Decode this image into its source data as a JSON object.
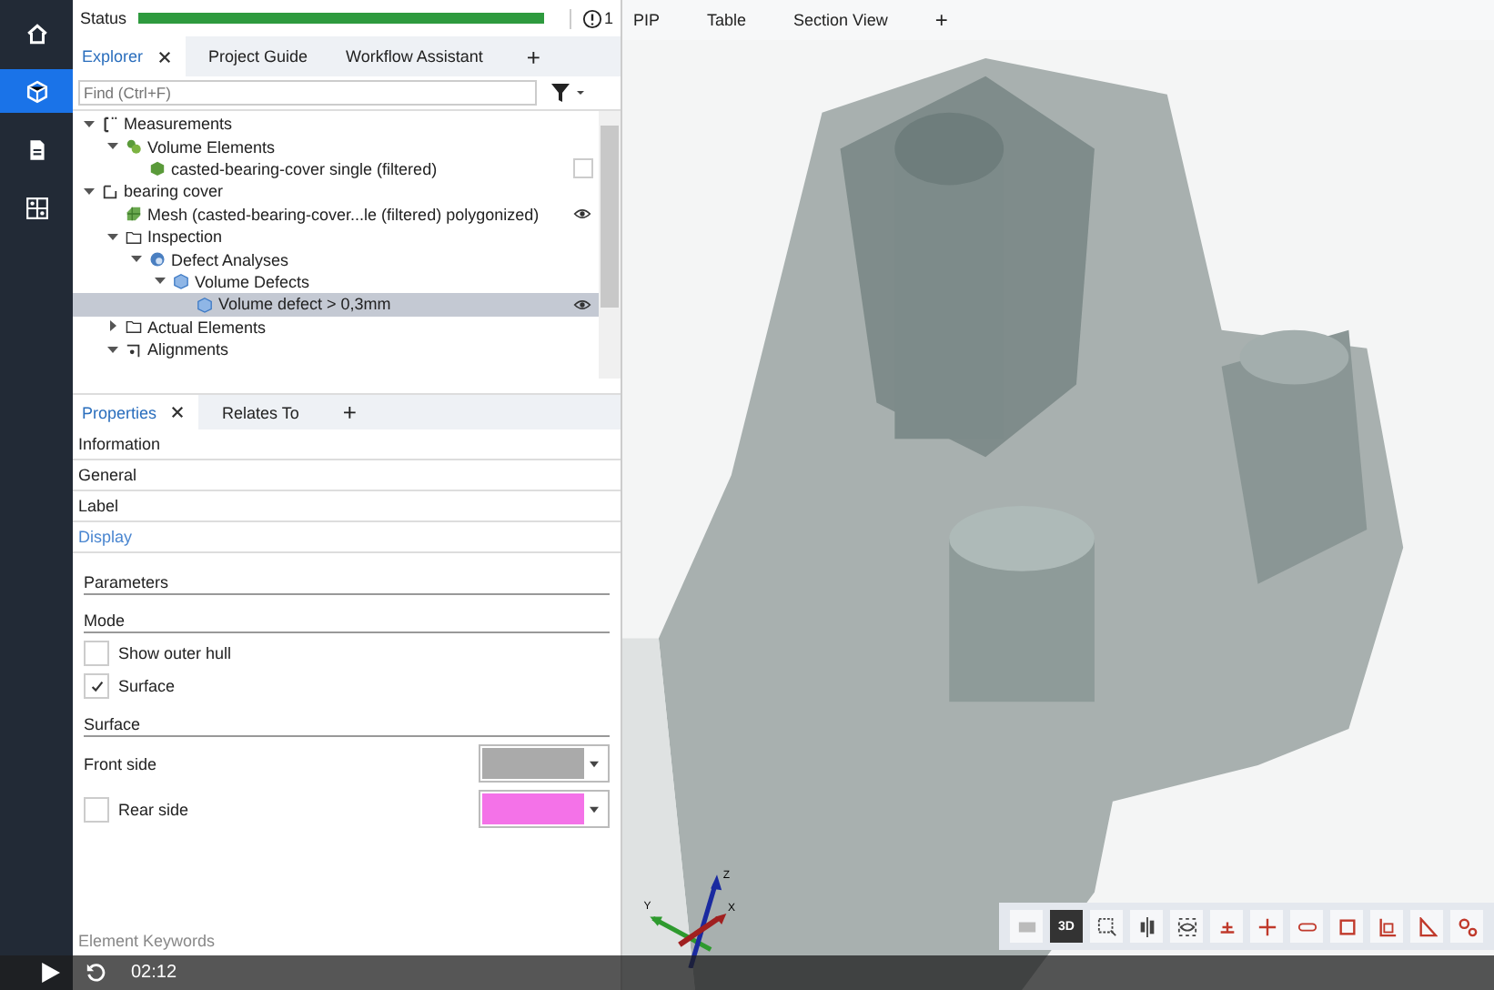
{
  "sidebar": {
    "items": [
      {
        "kind": "home",
        "selected": false
      },
      {
        "kind": "cube",
        "selected": true
      },
      {
        "kind": "document",
        "selected": false
      },
      {
        "kind": "grid",
        "selected": false
      }
    ]
  },
  "status": {
    "label": "Status",
    "level": 1,
    "count": "1"
  },
  "explorer": {
    "tabs": [
      {
        "label": "Explorer",
        "selected": true,
        "closable": true
      },
      {
        "label": "Project Guide",
        "selected": false,
        "closable": false
      },
      {
        "label": "Workflow Assistant",
        "selected": false,
        "closable": false
      }
    ],
    "add_tab": "+",
    "search": {
      "placeholder": "Find (Ctrl+F)"
    },
    "tree": [
      {
        "label": "Measurements",
        "kind": "measure",
        "expanded": true,
        "children": [
          {
            "label": "Volume Elements",
            "kind": "cluster",
            "expanded": true,
            "children": [
              {
                "label": "casted-bearing-cover single (filtered)",
                "kind": "solid",
                "checked": false,
                "selected": false
              }
            ]
          }
        ]
      },
      {
        "label": "bearing cover",
        "kind": "frame",
        "expanded": true,
        "children": [
          {
            "label": "Mesh (casted-bearing-cover...le (filtered) polygonized)",
            "kind": "mesh",
            "eye": true,
            "selected": false
          },
          {
            "label": "Inspection",
            "kind": "folder",
            "expanded": true,
            "children": [
              {
                "label": "Defect Analyses",
                "kind": "analysis",
                "expanded": true,
                "children": [
                  {
                    "label": "Volume Defects",
                    "kind": "defect",
                    "expanded": true,
                    "children": [
                      {
                        "label": "Volume defect > 0,3mm",
                        "kind": "defect",
                        "eye": true,
                        "selected": true
                      }
                    ]
                  }
                ]
              }
            ]
          },
          {
            "label": "Actual Elements",
            "kind": "folder",
            "expanded": false
          },
          {
            "label": "Alignments",
            "kind": "alignment",
            "expanded": true
          }
        ]
      }
    ]
  },
  "properties": {
    "tabs": [
      {
        "label": "Properties",
        "selected": true,
        "closable": true
      },
      {
        "label": "Relates To",
        "selected": false,
        "closable": false
      }
    ],
    "add_tab": "+",
    "sections": [
      {
        "label": "Information",
        "selected": false
      },
      {
        "label": "General",
        "selected": false
      },
      {
        "label": "Label",
        "selected": false
      },
      {
        "label": "Display",
        "selected": true
      }
    ],
    "display": [
      {
        "kind": "header",
        "label": "Parameters"
      },
      {
        "kind": "header",
        "label": "Mode"
      },
      {
        "kind": "checkbox",
        "label": "Show outer hull",
        "checked": false
      },
      {
        "kind": "checkbox",
        "label": "Surface",
        "checked": true
      },
      {
        "kind": "header",
        "label": "Surface"
      },
      {
        "kind": "color",
        "label": "Front side",
        "color": "#aaaaaa"
      },
      {
        "kind": "color",
        "label": "Rear side",
        "color": "#f472e8",
        "checked": false
      }
    ],
    "footer": "Element Keywords"
  },
  "viewport": {
    "tabs": [
      "PIP",
      "Table",
      "Section View"
    ],
    "add_tab": "+",
    "triad": {
      "x": "X",
      "y": "Y",
      "z": "Z"
    },
    "toolbar": [
      {
        "kind": "layout",
        "selected": false
      },
      {
        "kind": "text",
        "label": "3D",
        "selected": true
      },
      {
        "kind": "select",
        "selected": false
      },
      {
        "kind": "align",
        "selected": false
      },
      {
        "kind": "view",
        "selected": false
      },
      {
        "kind": "point",
        "selected": false
      },
      {
        "kind": "line",
        "selected": false
      },
      {
        "kind": "slot",
        "selected": false
      },
      {
        "kind": "square",
        "selected": false
      },
      {
        "kind": "frame",
        "selected": false
      },
      {
        "kind": "angle",
        "selected": false
      },
      {
        "kind": "chain",
        "selected": false
      }
    ]
  },
  "player": {
    "time": "02:12"
  }
}
